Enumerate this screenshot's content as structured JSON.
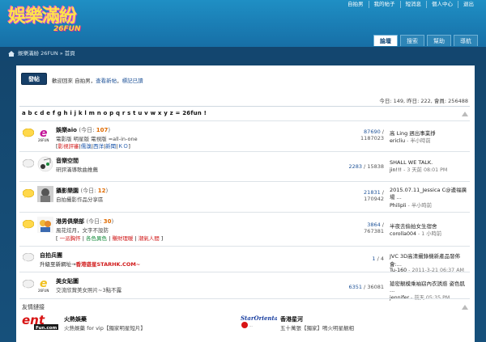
{
  "logo": {
    "line1": "娛樂滿紛",
    "line2": "26FUN"
  },
  "topnav": [
    "自拍男",
    "我的帖子",
    "短消息",
    "個人中心",
    "退出"
  ],
  "navtabs": [
    {
      "label": "論壇",
      "active": true
    },
    {
      "label": "搜索",
      "active": false
    },
    {
      "label": "幫助",
      "active": false
    },
    {
      "label": "導航",
      "active": false
    }
  ],
  "breadcrumb": "娛樂滿紛 26FUN » 首頁",
  "post_button": "發帖",
  "welcome": {
    "prefix": "歡迎回來 自拍男，",
    "link1": "查看新帖",
    "comma": "，",
    "link2": "標記已讀"
  },
  "stats": "今日: 149, 昨日: 222, 會員: 256488",
  "alphabet": "a b c d e f g h i j k l m n o p q r s t u v w x y z = 26fun !",
  "forums": [
    {
      "title": "娛樂aio",
      "today_prefix": "(今日: ",
      "today": "107",
      "today_suffix": ")",
      "desc": "電影版 明星版 電視版 =all-in-one",
      "sub": [
        "[",
        "影視評審",
        "|",
        "儒溴",
        "|",
        "西洋",
        "|",
        "新聞",
        "|",
        "ＫＯ",
        "]"
      ],
      "topics": "87690",
      "posts": "1187023",
      "last_title": "高 Ling 週出事業掙",
      "last_user": "ericliu",
      "last_time": "半小時前",
      "icon": "e-26fun-icon",
      "bubble": "new"
    },
    {
      "title": "音樂空間",
      "today_prefix": "",
      "today": "",
      "today_suffix": "",
      "desc": "研評滿導歌曲推薦",
      "sub": [],
      "topics": "2283",
      "posts": "15838",
      "last_title": "SHALL WE TALK.",
      "last_user": "jin!!!",
      "last_time": "3 天前 08:01 PM",
      "icon": "music-icon",
      "bubble": "old"
    },
    {
      "title": "攝影樂園",
      "today_prefix": "(今日: ",
      "today": "12",
      "today_suffix": ")",
      "desc": "自拍攝影作品分享區",
      "sub": [],
      "topics": "21831",
      "posts": "170942",
      "last_title": "2015.07.11_Jessica C@邊福廣場 ...",
      "last_user": "Philipli",
      "last_time": "半小時前",
      "icon": "photo-icon",
      "bubble": "new"
    },
    {
      "title": "港男俱樂部",
      "today_prefix": "(今日: ",
      "today": "30",
      "today_suffix": ")",
      "desc": "風花炫月，文字不設防",
      "sub": [
        "[",
        "一派胸怀",
        "|",
        "各色異色",
        "|",
        "賺財理暖",
        "|",
        "潮氣人間",
        "]"
      ],
      "topics": "3864",
      "posts": "767381",
      "last_title": "半夜去偷拍女生宿舍",
      "last_user": "corolla004",
      "last_time": "1 小時前",
      "icon": "hk-men-icon",
      "bubble": "new"
    },
    {
      "title": "自拍兵團",
      "today_prefix": "",
      "today": "",
      "today_suffix": "",
      "desc": "",
      "sub_plain": "升級至新網址→",
      "sub_red": "香港遊星STARHK.COM~",
      "topics": "1",
      "posts": "4",
      "last_title": "JVC 3D高清攝錄機新產品發佈會:...",
      "last_user": "Tu-160",
      "last_time": "2011-3-21 06:37 AM",
      "icon": "",
      "bubble": "old"
    },
    {
      "title": "美女貼圖",
      "today_prefix": "",
      "today": "",
      "today_suffix": "",
      "desc": "交流欣賞美女照片~3點不露",
      "sub": [],
      "topics": "6351",
      "posts": "36081",
      "last_title": "搶密靚模乘袖窈內衣誘惑 姿色肌 ...",
      "last_user": "jennifer",
      "last_time": "前天 05:35 PM",
      "icon": "e-26fun-icon",
      "bubble": "old"
    }
  ],
  "friends_header": "友情鏈接",
  "friends": [
    {
      "logo_top": "ent",
      "logo_bot": "Fun.com",
      "title": "火熱娛藥",
      "desc": "火熱娛藥 for vip【獨家明星短片】"
    },
    {
      "logo_top": "StarOriental",
      "logo_bot": "...",
      "title": "香港星河",
      "desc": "五十萬張【獨家】鳴火明星靚相"
    }
  ],
  "colors": {
    "header": "#1a7db4",
    "crumbbar": "#13466f",
    "today": "#e06b00",
    "link": "#225599",
    "red": "#d11a1a"
  }
}
